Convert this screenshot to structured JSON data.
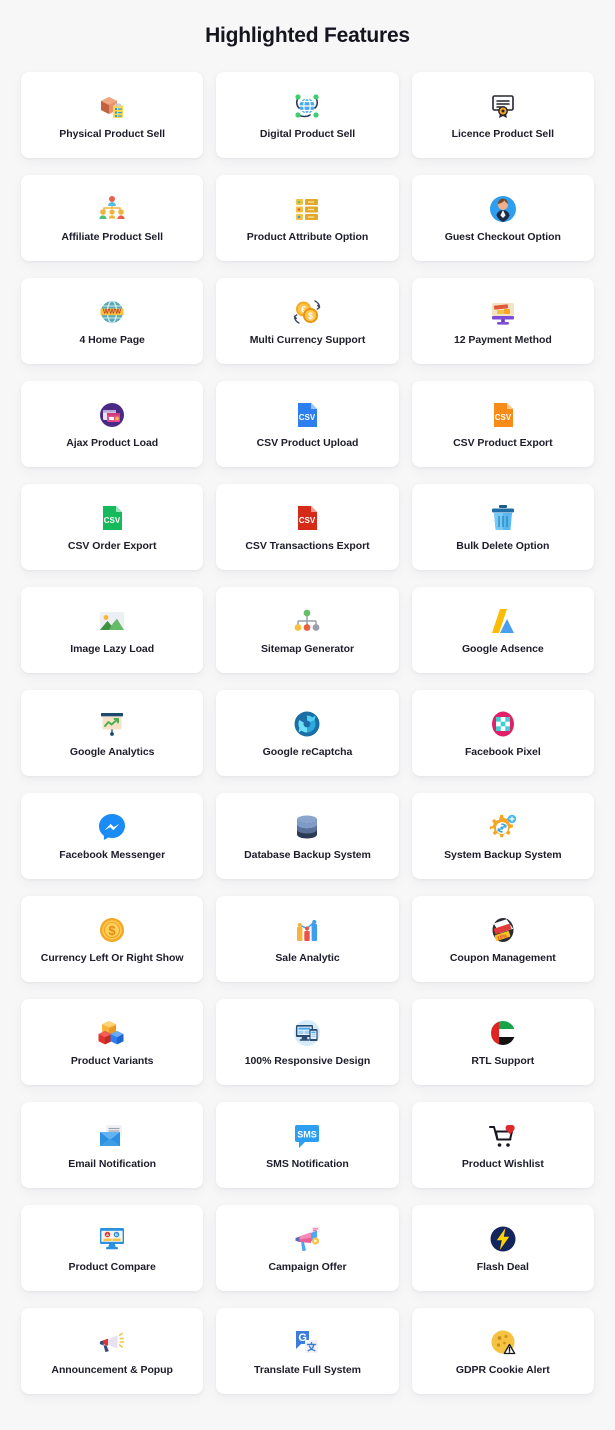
{
  "header": {
    "title": "Highlighted Features"
  },
  "colors": {
    "page_background": "#f7f7f8",
    "card_background": "#ffffff",
    "title_text": "#15151f",
    "label_text": "#1d1d2b"
  },
  "features": [
    {
      "label": "Physical Product Sell",
      "icon": "cardboard-box-checklist-icon"
    },
    {
      "label": "Digital Product Sell",
      "icon": "connected-globe-network-icon"
    },
    {
      "label": "Licence Product Sell",
      "icon": "certificate-award-icon"
    },
    {
      "label": "Affiliate Product Sell",
      "icon": "affiliate-people-network-icon"
    },
    {
      "label": "Product Attribute Option",
      "icon": "attribute-list-rows-icon"
    },
    {
      "label": "Guest Checkout Option",
      "icon": "guest-user-avatar-icon"
    },
    {
      "label": "4 Home Page",
      "icon": "www-globe-icon"
    },
    {
      "label": "Multi Currency Support",
      "icon": "euro-dollar-exchange-icon"
    },
    {
      "label": "12 Payment Method",
      "icon": "payment-monitor-card-icon"
    },
    {
      "label": "Ajax Product Load",
      "icon": "ajax-load-window-icon"
    },
    {
      "label": "CSV Product Upload",
      "icon": "csv-file-blue-icon"
    },
    {
      "label": "CSV Product Export",
      "icon": "csv-file-orange-icon"
    },
    {
      "label": "CSV Order Export",
      "icon": "csv-file-green-icon"
    },
    {
      "label": "CSV Transactions Export",
      "icon": "csv-file-red-icon"
    },
    {
      "label": "Bulk Delete Option",
      "icon": "trash-bin-icon"
    },
    {
      "label": "Image Lazy Load",
      "icon": "image-photo-icon"
    },
    {
      "label": "Sitemap Generator",
      "icon": "sitemap-tree-icon"
    },
    {
      "label": "Google Adsence",
      "icon": "google-adsense-icon"
    },
    {
      "label": "Google Analytics",
      "icon": "google-analytics-chart-icon"
    },
    {
      "label": "Google reCaptcha",
      "icon": "google-recaptcha-icon"
    },
    {
      "label": "Facebook Pixel",
      "icon": "facebook-pixel-icon"
    },
    {
      "label": "Facebook Messenger",
      "icon": "facebook-messenger-icon"
    },
    {
      "label": "Database Backup System",
      "icon": "database-cylinder-icon"
    },
    {
      "label": "System Backup System",
      "icon": "gear-sync-backup-icon"
    },
    {
      "label": "Currency Left Or Right Show",
      "icon": "dollar-coin-icon"
    },
    {
      "label": "Sale Analytic",
      "icon": "bar-chart-analytics-icon"
    },
    {
      "label": "Coupon Management",
      "icon": "coupon-discount-tag-icon"
    },
    {
      "label": "Product Variants",
      "icon": "colored-cubes-icon"
    },
    {
      "label": "100% Responsive Design",
      "icon": "responsive-devices-icon"
    },
    {
      "label": "RTL Support",
      "icon": "uae-flag-circle-icon"
    },
    {
      "label": "Email Notification",
      "icon": "email-envelope-icon"
    },
    {
      "label": "SMS Notification",
      "icon": "sms-bubble-icon"
    },
    {
      "label": "Product Wishlist",
      "icon": "cart-heart-wishlist-icon"
    },
    {
      "label": "Product Compare",
      "icon": "compare-monitor-ab-icon"
    },
    {
      "label": "Campaign Offer",
      "icon": "campaign-megaphone-icon"
    },
    {
      "label": "Flash Deal",
      "icon": "flash-lightning-circle-icon"
    },
    {
      "label": "Announcement & Popup",
      "icon": "announcement-megaphone-icon"
    },
    {
      "label": "Translate Full System",
      "icon": "google-translate-icon"
    },
    {
      "label": "GDPR Cookie Alert",
      "icon": "cookie-alert-icon"
    }
  ]
}
